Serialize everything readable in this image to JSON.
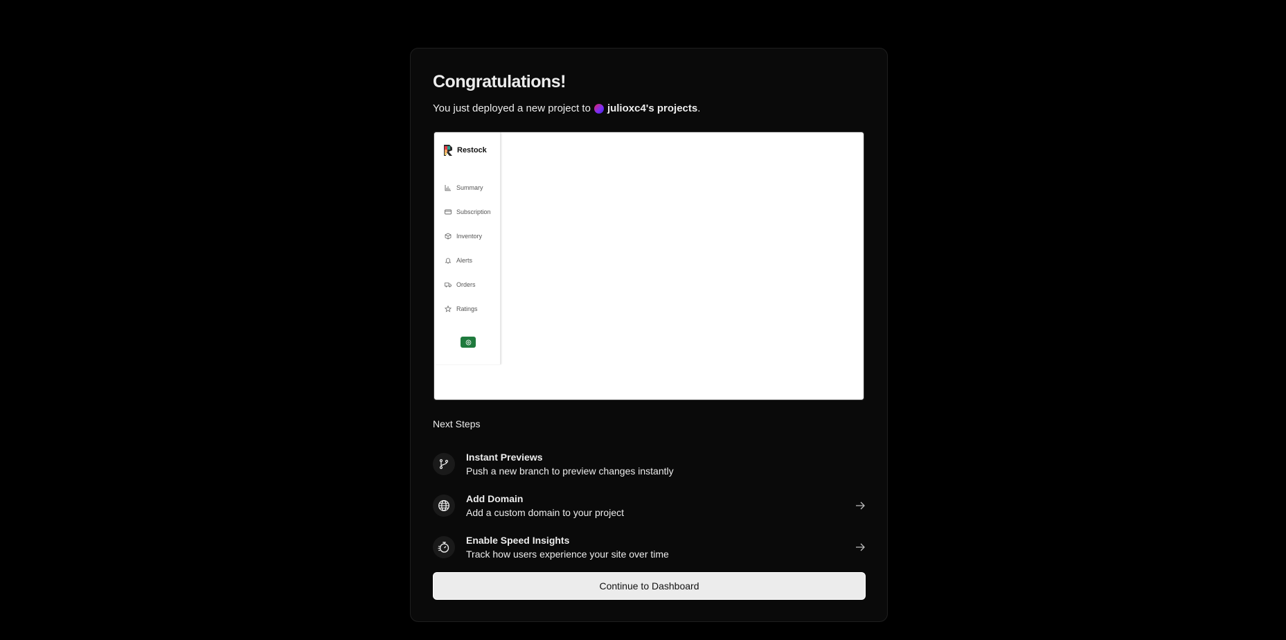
{
  "header": {
    "title": "Congratulations!",
    "subtitle_prefix": "You just deployed a new project to",
    "team_name": "julioxc4's projects",
    "subtitle_suffix": "."
  },
  "preview": {
    "app_name": "Restock",
    "nav_items": [
      {
        "label": "Summary",
        "icon": "bar-chart-icon"
      },
      {
        "label": "Subscription",
        "icon": "credit-card-icon"
      },
      {
        "label": "Inventory",
        "icon": "box-icon"
      },
      {
        "label": "Alerts",
        "icon": "bell-icon"
      },
      {
        "label": "Orders",
        "icon": "truck-icon"
      },
      {
        "label": "Ratings",
        "icon": "star-icon"
      }
    ],
    "help_icon": "help-icon",
    "accent_color": "#1f7a3d"
  },
  "next_steps": {
    "heading": "Next Steps",
    "items": [
      {
        "title": "Instant Previews",
        "description": "Push a new branch to preview changes instantly",
        "icon": "git-branch-icon",
        "has_arrow": false
      },
      {
        "title": "Add Domain",
        "description": "Add a custom domain to your project",
        "icon": "globe-icon",
        "has_arrow": true
      },
      {
        "title": "Enable Speed Insights",
        "description": "Track how users experience your site over time",
        "icon": "stopwatch-icon",
        "has_arrow": true
      }
    ]
  },
  "cta": {
    "label": "Continue to Dashboard"
  },
  "colors": {
    "background": "#000000",
    "card": "#0a0a0a",
    "text": "#ededed",
    "button_bg": "#ececec"
  }
}
